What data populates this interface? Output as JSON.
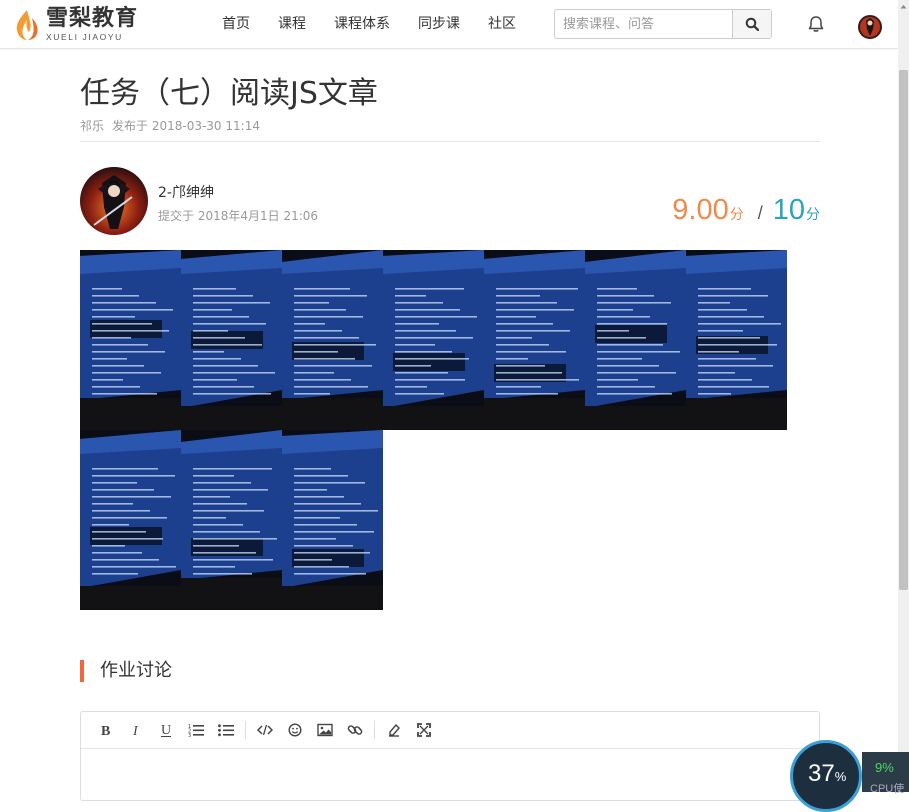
{
  "header": {
    "logo_cn": "雪梨教育",
    "logo_en": "XUELI JIAOYU",
    "nav": [
      "首页",
      "课程",
      "课程体系",
      "同步课",
      "社区"
    ],
    "search_placeholder": "搜索课程、问答"
  },
  "article": {
    "title": "任务（七）阅读JS文章",
    "author": "祁乐",
    "published": "发布于 2018-03-30 11:14"
  },
  "submission": {
    "user_name": "2-邝绅绅",
    "submitted": "提交于 2018年4月1日 21:06",
    "score": "9.00",
    "score_unit": "分",
    "separator": "/",
    "total": "10",
    "total_unit": "分",
    "photo_count": 10
  },
  "discussion": {
    "title": "作业讨论",
    "toolbar": [
      "bold",
      "italic",
      "underline",
      "ordered-list",
      "unordered-list",
      "code",
      "emoji",
      "image",
      "link",
      "eraser",
      "fullscreen"
    ]
  },
  "cpu_widget": {
    "percent": "37",
    "percent_sign": "%",
    "side_value": "9%",
    "side_label": "CPU使"
  },
  "colors": {
    "accent": "#f0693b",
    "score": "#f08a4b",
    "total": "#2aa3c4"
  }
}
